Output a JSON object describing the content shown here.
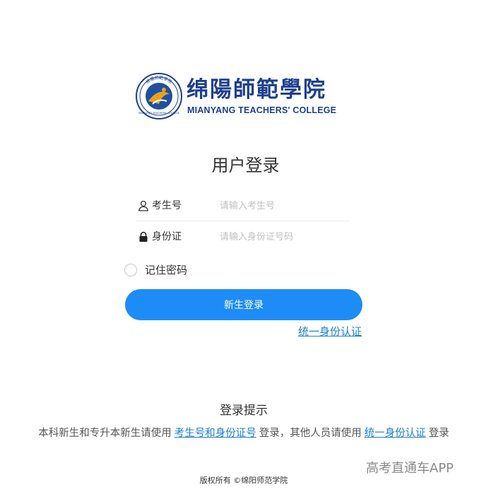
{
  "logo": {
    "name_cn": "绵陽師範學院",
    "name_en": "MIANYANG TEACHERS' COLLEGE",
    "emblem_text": "綿陽師範學院",
    "emblem_text_en": "MIANYANG TEACHERS' COLLEGE"
  },
  "login": {
    "title": "用户登录",
    "fields": [
      {
        "icon": "user-icon",
        "label": "考生号",
        "placeholder": "请输入考生号",
        "value": ""
      },
      {
        "icon": "lock-icon",
        "label": "身份证",
        "placeholder": "请输入身份证号码",
        "value": ""
      }
    ],
    "remember_label": "记住密码",
    "submit_label": "新生登录",
    "unified_auth_link": "统一身份认证"
  },
  "tips": {
    "title": "登录提示",
    "text_before": "本科新生和专升本新生请使用",
    "link1": "考生号和身份证号",
    "text_middle": "登录，其他人员请使用",
    "link2": "统一身份认证",
    "text_after": "登录"
  },
  "watermark": "高考直通车APP",
  "copyright": "版权所有 ©绵阳师范学院",
  "colors": {
    "primary": "#1e8cf7",
    "link": "#1e7fd6",
    "brand_blue": "#1e3f8f",
    "emblem_gold": "#e8a11d"
  }
}
